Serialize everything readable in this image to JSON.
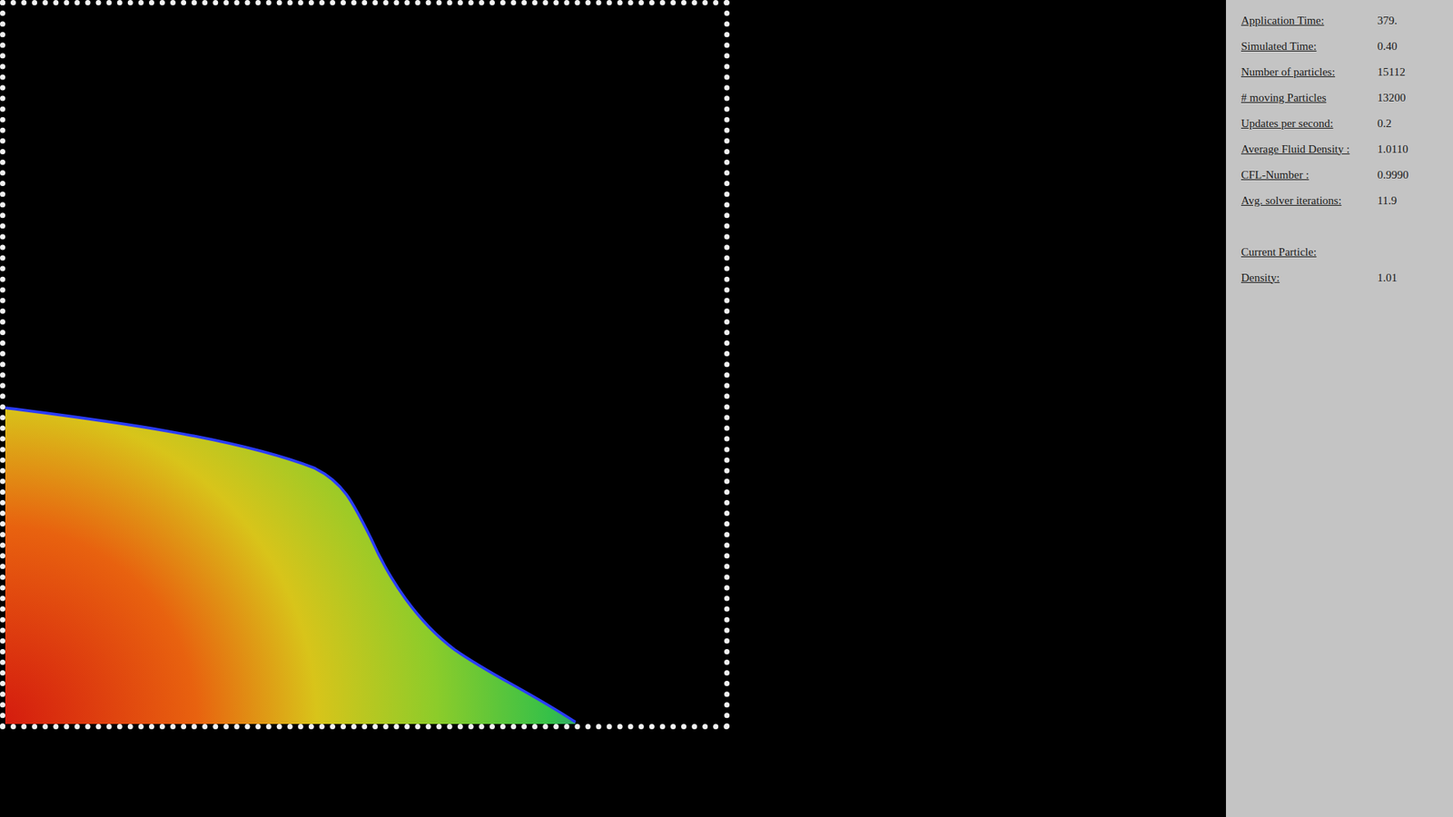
{
  "stats": [
    {
      "label": "Application Time:",
      "value": "379."
    },
    {
      "label": "Simulated Time:",
      "value": "0.40"
    },
    {
      "label": "Number of particles:",
      "value": "15112"
    },
    {
      "label": "# moving Particles",
      "value": "13200"
    },
    {
      "label": "Updates per second:",
      "value": "0.2"
    },
    {
      "label": "Average Fluid Density :",
      "value": "1.0110"
    },
    {
      "label": "CFL-Number :",
      "value": "0.9990"
    },
    {
      "label": "Avg. solver iterations:",
      "value": "11.9"
    }
  ],
  "current_particle": {
    "heading": "Current Particle:",
    "fields": [
      {
        "label": "Density:",
        "value": "1.01"
      }
    ]
  }
}
